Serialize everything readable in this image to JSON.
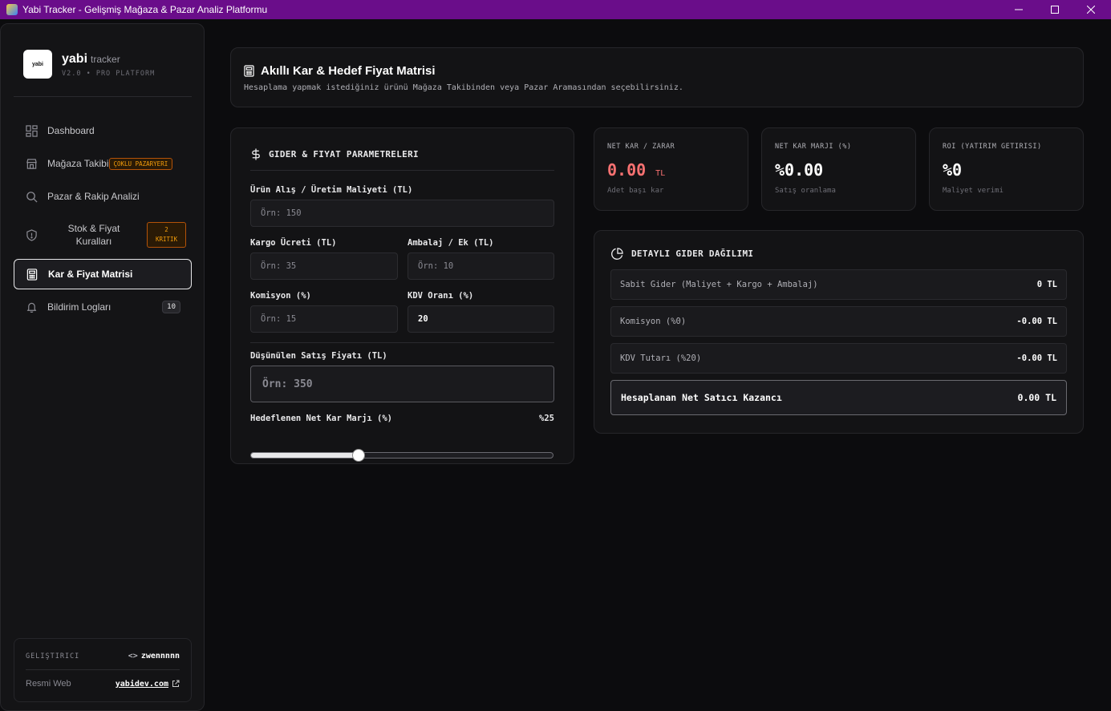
{
  "window": {
    "title": "Yabi Tracker - Gelişmiş Mağaza & Pazar Analiz Platformu",
    "minimize": "—",
    "maximize": "☐",
    "close": "✕"
  },
  "brand": {
    "logo_text": "yabi",
    "name": "yabi",
    "sub": "tracker",
    "version": "V2.0 • PRO PLATFORM"
  },
  "sidebar": {
    "items": [
      {
        "label": "Dashboard",
        "icon": "dashboard-icon"
      },
      {
        "label": "Mağaza Takibi",
        "icon": "store-icon",
        "badge": "ÇOKLU PAZARYERI"
      },
      {
        "label": "Pazar & Rakip Analizi",
        "icon": "search-icon"
      },
      {
        "label_line1": "Stok & Fiyat",
        "label_line2": "Kuralları",
        "icon": "shield-icon",
        "badge_line1": "2",
        "badge_line2": "KRITIK"
      },
      {
        "label": "Kar & Fiyat Matrisi",
        "icon": "calculator-icon",
        "active": true
      },
      {
        "label": "Bildirim Logları",
        "icon": "bell-icon",
        "count": "10"
      }
    ]
  },
  "developer": {
    "label": "GELIŞTIRICI",
    "handle": "zwennnnn",
    "web_label": "Resmi Web",
    "web_link": "yabidev.com"
  },
  "header": {
    "title": "Akıllı Kar & Hedef Fiyat Matrisi",
    "subtitle": "Hesaplama yapmak istediğiniz ürünü Mağaza Takibinden veya Pazar Aramasından seçebilirsiniz."
  },
  "params": {
    "title": "GIDER & FIYAT PARAMETRELERI",
    "cost_label": "Ürün Alış / Üretim Maliyeti (TL)",
    "cost_placeholder": "Örn: 150",
    "cargo_label": "Kargo Ücreti (TL)",
    "cargo_placeholder": "Örn: 35",
    "pack_label": "Ambalaj / Ek (TL)",
    "pack_placeholder": "Örn: 10",
    "commission_label": "Komisyon (%)",
    "commission_placeholder": "Örn: 15",
    "vat_label": "KDV Oranı (%)",
    "vat_value": "20",
    "price_label": "Düşünülen Satış Fiyatı (TL)",
    "price_placeholder": "Örn: 350",
    "margin_label": "Hedeflenen Net Kar Marjı (%)",
    "margin_display": "%25",
    "margin_value": 25,
    "margin_max": 70
  },
  "stats": [
    {
      "label": "NET KAR / ZARAR",
      "value": "0.00",
      "unit": "TL",
      "note": "Adet başı kar"
    },
    {
      "label": "NET KAR MARJI (%)",
      "value": "%0.00",
      "note": "Satış oranlama"
    },
    {
      "label": "ROI (YATIRIM GETIRISI)",
      "value": "%0",
      "note": "Maliyet verimi"
    }
  ],
  "breakdown": {
    "title": "DETAYLI GIDER DAĞILIMI",
    "rows": [
      {
        "label": "Sabit Gider (Maliyet + Kargo + Ambalaj)",
        "value": "0 TL"
      },
      {
        "label": "Komisyon (%0)",
        "value": "-0.00 TL"
      },
      {
        "label": "KDV Tutarı (%20)",
        "value": "-0.00 TL"
      }
    ],
    "total_label": "Hesaplanan Net Satıcı Kazancı",
    "total_value": "0.00 TL"
  },
  "colors": {
    "titlebar": "#6a0d8a",
    "negative": "#f87171",
    "badge": "#f59e0b"
  }
}
